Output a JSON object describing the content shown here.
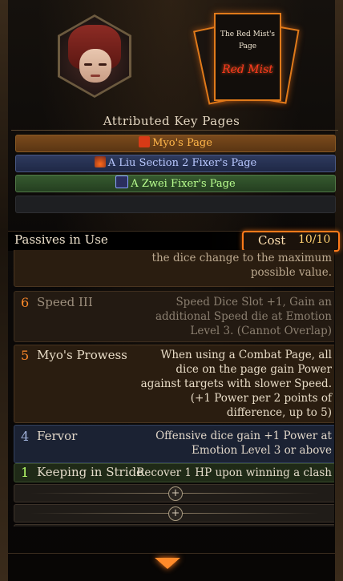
{
  "key_page": {
    "title": "The Red Mist's Page",
    "logo_text": "Red Mist"
  },
  "attributed": {
    "title": "Attributed Key Pages",
    "pages": [
      {
        "label": "Myo's Page",
        "color": "#ffb64a",
        "icon": "red-mark-icon"
      },
      {
        "label": "A Liu Section 2 Fixer's Page",
        "color": "#b9c8ff",
        "icon": "flame-icon"
      },
      {
        "label": "A Zwei Fixer's Page",
        "color": "#b9ff8f",
        "icon": "book-icon"
      }
    ]
  },
  "passives": {
    "title": "Passives in Use",
    "cost_label": "Cost",
    "cost_value": "10/10",
    "rows": [
      {
        "num": "",
        "name": "",
        "desc": "lowest value, the speed value of\nthe dice change to the maximum\npossible value."
      },
      {
        "num": "6",
        "name": "Speed III",
        "desc": "Speed Dice Slot +1, Gain an\nadditional Speed die at Emotion\nLevel 3. (Cannot Overlap)"
      },
      {
        "num": "5",
        "name": "Myo's Prowess",
        "desc": "When using a Combat Page, all\ndice on the page gain Power\nagainst targets with slower Speed.\n(+1 Power per 2 points of\ndifference, up to 5)"
      },
      {
        "num": "4",
        "name": "Fervor",
        "desc": "Offensive dice gain +1 Power at\nEmotion Level 3 or above"
      },
      {
        "num": "1",
        "name": "Keeping in Stride",
        "desc": "Recover 1 HP upon winning a clash"
      }
    ]
  }
}
